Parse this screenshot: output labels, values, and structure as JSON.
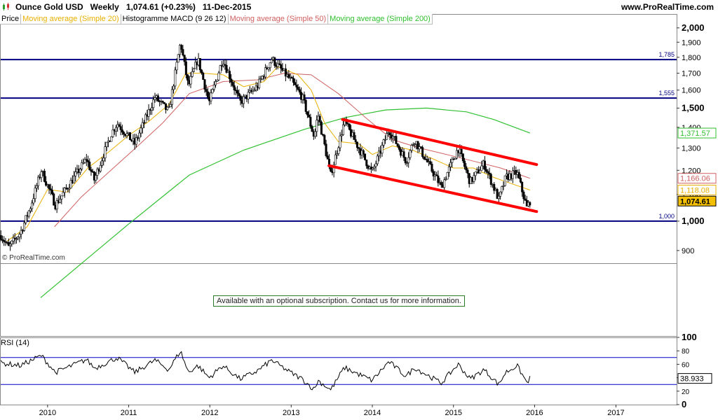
{
  "header": {
    "title": "Ounce Gold USD   Weekly   1,074.61 (+0.23%)   11-Dec-2015",
    "site": "www.ProRealTime.com"
  },
  "legend": [
    {
      "label": "Price",
      "color": "#000000"
    },
    {
      "label": "Moving average (Simple 20)",
      "color": "#e8b000"
    },
    {
      "label": "Histogramme MACD (9 26 12)",
      "color": "#000000"
    },
    {
      "label": "Moving average (Simple 50)",
      "color": "#d06060"
    },
    {
      "label": "Moving average (Simple 200)",
      "color": "#30c030"
    }
  ],
  "credit": "© ProRealTime.com",
  "subscription_note": "Available with an optional subscription. Contact us for more information.",
  "rsi_label": "RSI (14)",
  "chart_data": [
    {
      "type": "candlestick",
      "scale": "log",
      "ylim": [
        860,
        2050
      ],
      "y_ticks": [
        900,
        1000,
        1100,
        1200,
        1300,
        1400,
        1500,
        1600,
        1700,
        1800,
        1900,
        2000
      ],
      "y_tick_labels": [
        "900",
        "1,000",
        "1,100",
        "1,200",
        "1,300",
        "1,400",
        "1,500",
        "1,600",
        "1,700",
        "1,800",
        "1,900",
        "2,000"
      ],
      "y_major": [
        1000,
        1500,
        2000
      ],
      "x_range": [
        "2009-06-01",
        "2017-10-01"
      ],
      "x_ticks": [
        "2010",
        "2011",
        "2012",
        "2013",
        "2014",
        "2015",
        "2016",
        "2017"
      ],
      "price_path": [
        [
          "2009-06-05",
          950
        ],
        [
          "2009-07-10",
          910
        ],
        [
          "2009-09-01",
          960
        ],
        [
          "2009-10-15",
          1050
        ],
        [
          "2009-12-04",
          1200
        ],
        [
          "2010-02-05",
          1060
        ],
        [
          "2010-04-01",
          1130
        ],
        [
          "2010-06-25",
          1250
        ],
        [
          "2010-07-30",
          1160
        ],
        [
          "2010-10-15",
          1370
        ],
        [
          "2010-11-10",
          1420
        ],
        [
          "2011-01-28",
          1320
        ],
        [
          "2011-04-29",
          1560
        ],
        [
          "2011-06-30",
          1480
        ],
        [
          "2011-08-22",
          1900
        ],
        [
          "2011-09-26",
          1620
        ],
        [
          "2011-11-08",
          1790
        ],
        [
          "2011-12-29",
          1530
        ],
        [
          "2012-02-28",
          1790
        ],
        [
          "2012-05-16",
          1530
        ],
        [
          "2012-08-01",
          1620
        ],
        [
          "2012-10-05",
          1790
        ],
        [
          "2012-12-28",
          1660
        ],
        [
          "2013-02-20",
          1560
        ],
        [
          "2013-04-15",
          1350
        ],
        [
          "2013-05-01",
          1470
        ],
        [
          "2013-06-28",
          1180
        ],
        [
          "2013-08-28",
          1430
        ],
        [
          "2013-12-31",
          1190
        ],
        [
          "2014-03-17",
          1390
        ],
        [
          "2014-06-02",
          1240
        ],
        [
          "2014-07-10",
          1340
        ],
        [
          "2014-11-07",
          1130
        ],
        [
          "2015-01-22",
          1300
        ],
        [
          "2015-03-17",
          1150
        ],
        [
          "2015-05-18",
          1230
        ],
        [
          "2015-07-24",
          1080
        ],
        [
          "2015-08-24",
          1170
        ],
        [
          "2015-10-14",
          1190
        ],
        [
          "2015-11-27",
          1050
        ],
        [
          "2015-12-11",
          1074.61
        ]
      ],
      "ma20_path": [
        [
          "2009-07-01",
          930
        ],
        [
          "2009-10-01",
          980
        ],
        [
          "2010-01-01",
          1120
        ],
        [
          "2010-04-01",
          1110
        ],
        [
          "2010-07-01",
          1210
        ],
        [
          "2010-10-01",
          1280
        ],
        [
          "2011-01-01",
          1360
        ],
        [
          "2011-04-01",
          1430
        ],
        [
          "2011-07-01",
          1520
        ],
        [
          "2011-09-15",
          1700
        ],
        [
          "2011-12-01",
          1700
        ],
        [
          "2012-03-01",
          1690
        ],
        [
          "2012-06-01",
          1620
        ],
        [
          "2012-09-01",
          1650
        ],
        [
          "2012-11-01",
          1740
        ],
        [
          "2013-02-01",
          1690
        ],
        [
          "2013-04-01",
          1600
        ],
        [
          "2013-06-01",
          1420
        ],
        [
          "2013-08-01",
          1330
        ],
        [
          "2013-11-01",
          1320
        ],
        [
          "2014-01-01",
          1270
        ],
        [
          "2014-04-01",
          1310
        ],
        [
          "2014-07-01",
          1290
        ],
        [
          "2014-10-01",
          1250
        ],
        [
          "2015-01-01",
          1210
        ],
        [
          "2015-04-01",
          1210
        ],
        [
          "2015-07-01",
          1170
        ],
        [
          "2015-10-01",
          1140
        ],
        [
          "2015-12-11",
          1118.08
        ]
      ],
      "ma50_path": [
        [
          "2010-02-01",
          980
        ],
        [
          "2010-06-01",
          1090
        ],
        [
          "2010-10-01",
          1190
        ],
        [
          "2011-02-01",
          1300
        ],
        [
          "2011-06-01",
          1420
        ],
        [
          "2011-10-01",
          1580
        ],
        [
          "2012-03-01",
          1650
        ],
        [
          "2012-08-01",
          1660
        ],
        [
          "2012-12-01",
          1700
        ],
        [
          "2013-04-01",
          1690
        ],
        [
          "2013-08-01",
          1580
        ],
        [
          "2013-12-01",
          1450
        ],
        [
          "2014-04-01",
          1340
        ],
        [
          "2014-08-01",
          1300
        ],
        [
          "2014-12-01",
          1270
        ],
        [
          "2015-04-01",
          1240
        ],
        [
          "2015-08-01",
          1210
        ],
        [
          "2015-12-11",
          1166.06
        ]
      ],
      "ma200_path": [
        [
          "2009-12-01",
          760
        ],
        [
          "2011-01-01",
          990
        ],
        [
          "2011-10-01",
          1180
        ],
        [
          "2012-06-01",
          1290
        ],
        [
          "2013-03-01",
          1390
        ],
        [
          "2013-09-01",
          1450
        ],
        [
          "2014-03-01",
          1490
        ],
        [
          "2014-09-01",
          1500
        ],
        [
          "2015-03-01",
          1480
        ],
        [
          "2015-07-01",
          1440
        ],
        [
          "2015-12-11",
          1371.57
        ]
      ],
      "horizontal_levels": [
        1785,
        1555,
        1000
      ],
      "horizontal_level_labels": [
        "1,785",
        "1,555",
        "1,000"
      ],
      "channel_lines": [
        [
          [
            "2013-08-20",
            1440
          ],
          [
            "2016-01-10",
            1225
          ]
        ],
        [
          [
            "2013-06-20",
            1220
          ],
          [
            "2016-01-10",
            1035
          ]
        ]
      ],
      "value_tags": [
        {
          "label": "1,371.57",
          "value": 1371.57,
          "color": "#30c030"
        },
        {
          "label": "1,166.06",
          "value": 1166.06,
          "color": "#d06060"
        },
        {
          "label": "1,118.08",
          "value": 1118.08,
          "color": "#e8b000"
        },
        {
          "label": "1,074.61",
          "value": 1074.61,
          "color": "#000000",
          "bg": "#f5c000"
        }
      ],
      "colors": {
        "price": "#000000",
        "ma20": "#e8b000",
        "ma50": "#d06060",
        "ma200": "#30c030",
        "levels": "#000080",
        "channel": "#ff0000"
      }
    },
    {
      "type": "line",
      "title": "RSI (14)",
      "ylim": [
        0,
        100
      ],
      "y_ticks": [
        0,
        20,
        40,
        60,
        80,
        100
      ],
      "y_tick_labels": [
        "0",
        "20",
        "40",
        "60",
        "80",
        "100"
      ],
      "bands": [
        70,
        30
      ],
      "rsi_path": [
        [
          "2009-06-05",
          62
        ],
        [
          "2009-09-01",
          58
        ],
        [
          "2009-12-04",
          73
        ],
        [
          "2010-02-05",
          48
        ],
        [
          "2010-06-25",
          67
        ],
        [
          "2010-08-01",
          54
        ],
        [
          "2010-11-10",
          70
        ],
        [
          "2011-01-28",
          48
        ],
        [
          "2011-04-29",
          66
        ],
        [
          "2011-06-30",
          52
        ],
        [
          "2011-08-22",
          80
        ],
        [
          "2011-09-26",
          48
        ],
        [
          "2011-11-08",
          58
        ],
        [
          "2011-12-29",
          40
        ],
        [
          "2012-02-28",
          58
        ],
        [
          "2012-05-16",
          38
        ],
        [
          "2012-08-01",
          50
        ],
        [
          "2012-10-05",
          66
        ],
        [
          "2012-12-28",
          48
        ],
        [
          "2013-02-20",
          38
        ],
        [
          "2013-04-15",
          22
        ],
        [
          "2013-05-01",
          36
        ],
        [
          "2013-06-28",
          22
        ],
        [
          "2013-08-28",
          55
        ],
        [
          "2013-12-31",
          36
        ],
        [
          "2014-03-17",
          64
        ],
        [
          "2014-06-02",
          42
        ],
        [
          "2014-07-10",
          55
        ],
        [
          "2014-11-07",
          32
        ],
        [
          "2015-01-22",
          60
        ],
        [
          "2015-03-17",
          38
        ],
        [
          "2015-05-18",
          52
        ],
        [
          "2015-07-24",
          30
        ],
        [
          "2015-08-24",
          48
        ],
        [
          "2015-10-14",
          58
        ],
        [
          "2015-11-27",
          33
        ],
        [
          "2015-12-11",
          38.933
        ]
      ],
      "value_tags": [
        {
          "label": "38.933",
          "value": 38.933
        }
      ]
    }
  ]
}
